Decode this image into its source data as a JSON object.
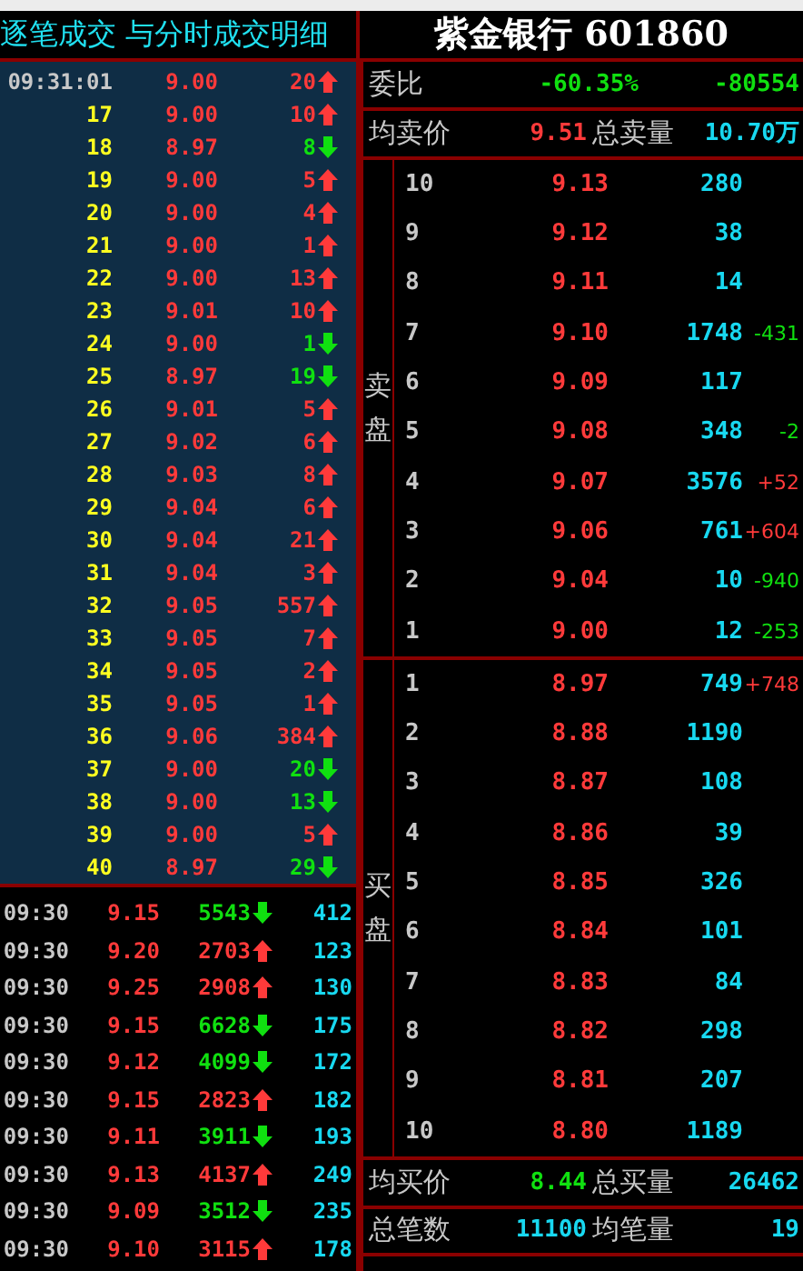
{
  "tick_panel": {
    "title": "逐笔成交 与分时成交明细",
    "ticks": [
      {
        "kind": "time",
        "label": "09:31:01",
        "price": "9.00",
        "volume": "20",
        "rising": true
      },
      {
        "kind": "seq",
        "label": "17",
        "price": "9.00",
        "volume": "10",
        "rising": true
      },
      {
        "kind": "seq",
        "label": "18",
        "price": "8.97",
        "volume": "8",
        "rising": false
      },
      {
        "kind": "seq",
        "label": "19",
        "price": "9.00",
        "volume": "5",
        "rising": true
      },
      {
        "kind": "seq",
        "label": "20",
        "price": "9.00",
        "volume": "4",
        "rising": true
      },
      {
        "kind": "seq",
        "label": "21",
        "price": "9.00",
        "volume": "1",
        "rising": true
      },
      {
        "kind": "seq",
        "label": "22",
        "price": "9.00",
        "volume": "13",
        "rising": true
      },
      {
        "kind": "seq",
        "label": "23",
        "price": "9.01",
        "volume": "10",
        "rising": true
      },
      {
        "kind": "seq",
        "label": "24",
        "price": "9.00",
        "volume": "1",
        "rising": false
      },
      {
        "kind": "seq",
        "label": "25",
        "price": "8.97",
        "volume": "19",
        "rising": false
      },
      {
        "kind": "seq",
        "label": "26",
        "price": "9.01",
        "volume": "5",
        "rising": true
      },
      {
        "kind": "seq",
        "label": "27",
        "price": "9.02",
        "volume": "6",
        "rising": true
      },
      {
        "kind": "seq",
        "label": "28",
        "price": "9.03",
        "volume": "8",
        "rising": true
      },
      {
        "kind": "seq",
        "label": "29",
        "price": "9.04",
        "volume": "6",
        "rising": true
      },
      {
        "kind": "seq",
        "label": "30",
        "price": "9.04",
        "volume": "21",
        "rising": true
      },
      {
        "kind": "seq",
        "label": "31",
        "price": "9.04",
        "volume": "3",
        "rising": true
      },
      {
        "kind": "seq",
        "label": "32",
        "price": "9.05",
        "volume": "557",
        "rising": true
      },
      {
        "kind": "seq",
        "label": "33",
        "price": "9.05",
        "volume": "7",
        "rising": true
      },
      {
        "kind": "seq",
        "label": "34",
        "price": "9.05",
        "volume": "2",
        "rising": true
      },
      {
        "kind": "seq",
        "label": "35",
        "price": "9.05",
        "volume": "1",
        "rising": true
      },
      {
        "kind": "seq",
        "label": "36",
        "price": "9.06",
        "volume": "384",
        "rising": true
      },
      {
        "kind": "seq",
        "label": "37",
        "price": "9.00",
        "volume": "20",
        "rising": false
      },
      {
        "kind": "seq",
        "label": "38",
        "price": "9.00",
        "volume": "13",
        "rising": false
      },
      {
        "kind": "seq",
        "label": "39",
        "price": "9.00",
        "volume": "5",
        "rising": true
      },
      {
        "kind": "seq",
        "label": "40",
        "price": "8.97",
        "volume": "29",
        "rising": false
      }
    ],
    "minute_rows": [
      {
        "time": "09:30",
        "price": "9.15",
        "volume": "5543",
        "rising": false,
        "count": "412"
      },
      {
        "time": "09:30",
        "price": "9.20",
        "volume": "2703",
        "rising": true,
        "count": "123"
      },
      {
        "time": "09:30",
        "price": "9.25",
        "volume": "2908",
        "rising": true,
        "count": "130"
      },
      {
        "time": "09:30",
        "price": "9.15",
        "volume": "6628",
        "rising": false,
        "count": "175"
      },
      {
        "time": "09:30",
        "price": "9.12",
        "volume": "4099",
        "rising": false,
        "count": "172"
      },
      {
        "time": "09:30",
        "price": "9.15",
        "volume": "2823",
        "rising": true,
        "count": "182"
      },
      {
        "time": "09:30",
        "price": "9.11",
        "volume": "3911",
        "rising": false,
        "count": "193"
      },
      {
        "time": "09:30",
        "price": "9.13",
        "volume": "4137",
        "rising": true,
        "count": "249"
      },
      {
        "time": "09:30",
        "price": "9.09",
        "volume": "3512",
        "rising": false,
        "count": "235"
      },
      {
        "time": "09:30",
        "price": "9.10",
        "volume": "3115",
        "rising": true,
        "count": "178"
      }
    ]
  },
  "quote_panel": {
    "title": "紫金银行 601860",
    "ratio": {
      "label": "委比",
      "percent": "-60.35%",
      "difference": "-80554"
    },
    "sell_summary": {
      "avg_label": "均卖价",
      "avg_price": "9.51",
      "total_label": "总卖量",
      "total": "10.70万"
    },
    "sell_label": "卖盘",
    "sell_levels": [
      {
        "level": "10",
        "price": "9.13",
        "volume": "280"
      },
      {
        "level": "9",
        "price": "9.12",
        "volume": "38"
      },
      {
        "level": "8",
        "price": "9.11",
        "volume": "14"
      },
      {
        "level": "7",
        "price": "9.10",
        "volume": "1748",
        "change": "-431",
        "rising": false
      },
      {
        "level": "6",
        "price": "9.09",
        "volume": "117"
      },
      {
        "level": "5",
        "price": "9.08",
        "volume": "348",
        "change": "-2",
        "rising": false
      },
      {
        "level": "4",
        "price": "9.07",
        "volume": "3576",
        "change": "+52",
        "rising": true
      },
      {
        "level": "3",
        "price": "9.06",
        "volume": "761",
        "change": "+604",
        "rising": true
      },
      {
        "level": "2",
        "price": "9.04",
        "volume": "10",
        "change": "-940",
        "rising": false
      },
      {
        "level": "1",
        "price": "9.00",
        "volume": "12",
        "change": "-253",
        "rising": false
      }
    ],
    "buy_label": "买盘",
    "buy_levels": [
      {
        "level": "1",
        "price": "8.97",
        "volume": "749",
        "change": "+748",
        "rising": true
      },
      {
        "level": "2",
        "price": "8.88",
        "volume": "1190"
      },
      {
        "level": "3",
        "price": "8.87",
        "volume": "108"
      },
      {
        "level": "4",
        "price": "8.86",
        "volume": "39"
      },
      {
        "level": "5",
        "price": "8.85",
        "volume": "326"
      },
      {
        "level": "6",
        "price": "8.84",
        "volume": "101"
      },
      {
        "level": "7",
        "price": "8.83",
        "volume": "84"
      },
      {
        "level": "8",
        "price": "8.82",
        "volume": "298"
      },
      {
        "level": "9",
        "price": "8.81",
        "volume": "207"
      },
      {
        "level": "10",
        "price": "8.80",
        "volume": "1189"
      }
    ],
    "buy_summary": {
      "avg_label": "均买价",
      "avg_price": "8.44",
      "total_label": "总买量",
      "total": "26462"
    },
    "count_summary": {
      "count_label": "总笔数",
      "count": "11100",
      "avg_label": "均笔量",
      "avg": "19"
    }
  }
}
